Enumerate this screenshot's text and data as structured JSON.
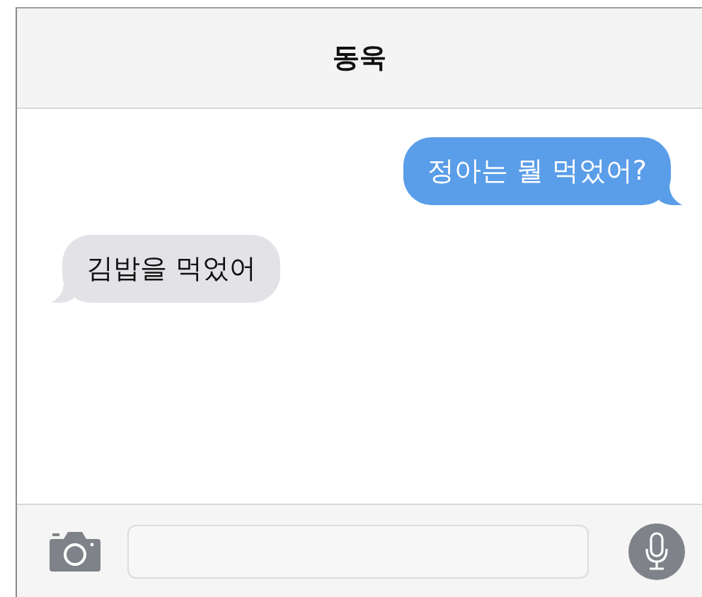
{
  "header": {
    "title": "동욱"
  },
  "messages": [
    {
      "kind": "sent",
      "text": "정아는 뭘 먹었어?"
    },
    {
      "kind": "received",
      "text": "김밥을 먹었어"
    }
  ]
}
